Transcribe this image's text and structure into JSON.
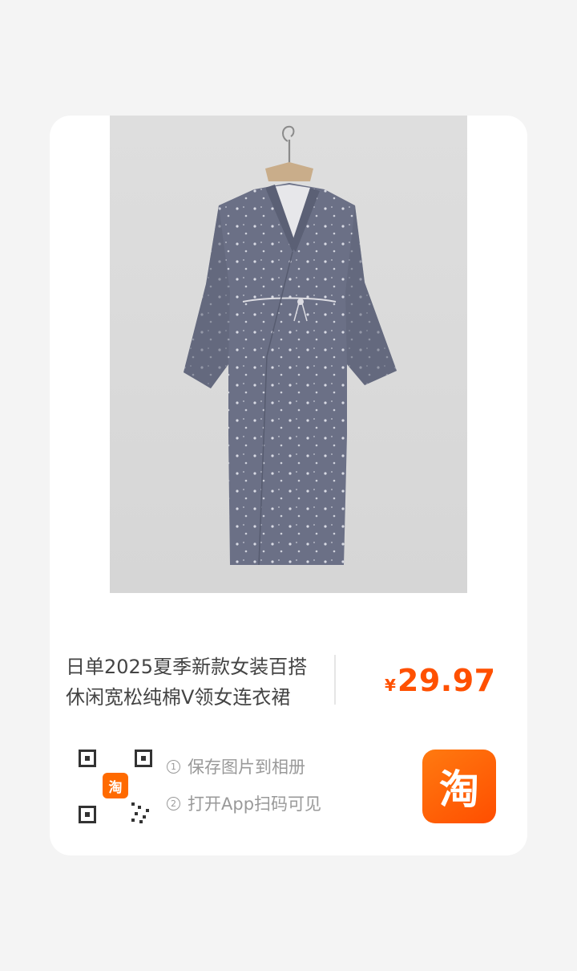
{
  "product": {
    "title": "日单2025夏季新款女装百搭休闲宽松纯棉V领女连衣裙",
    "currency": "¥",
    "price": "29.97"
  },
  "qr": {
    "logo_glyph": "淘"
  },
  "instructions": {
    "step1_num": "1",
    "step1_text": "保存图片到相册",
    "step2_num": "2",
    "step2_text": "打开App扫码可见"
  },
  "app_badge": {
    "glyph": "淘"
  },
  "colors": {
    "accent": "#ff5000",
    "app_orange": "#ff6a00",
    "garment": "#6b7086"
  }
}
